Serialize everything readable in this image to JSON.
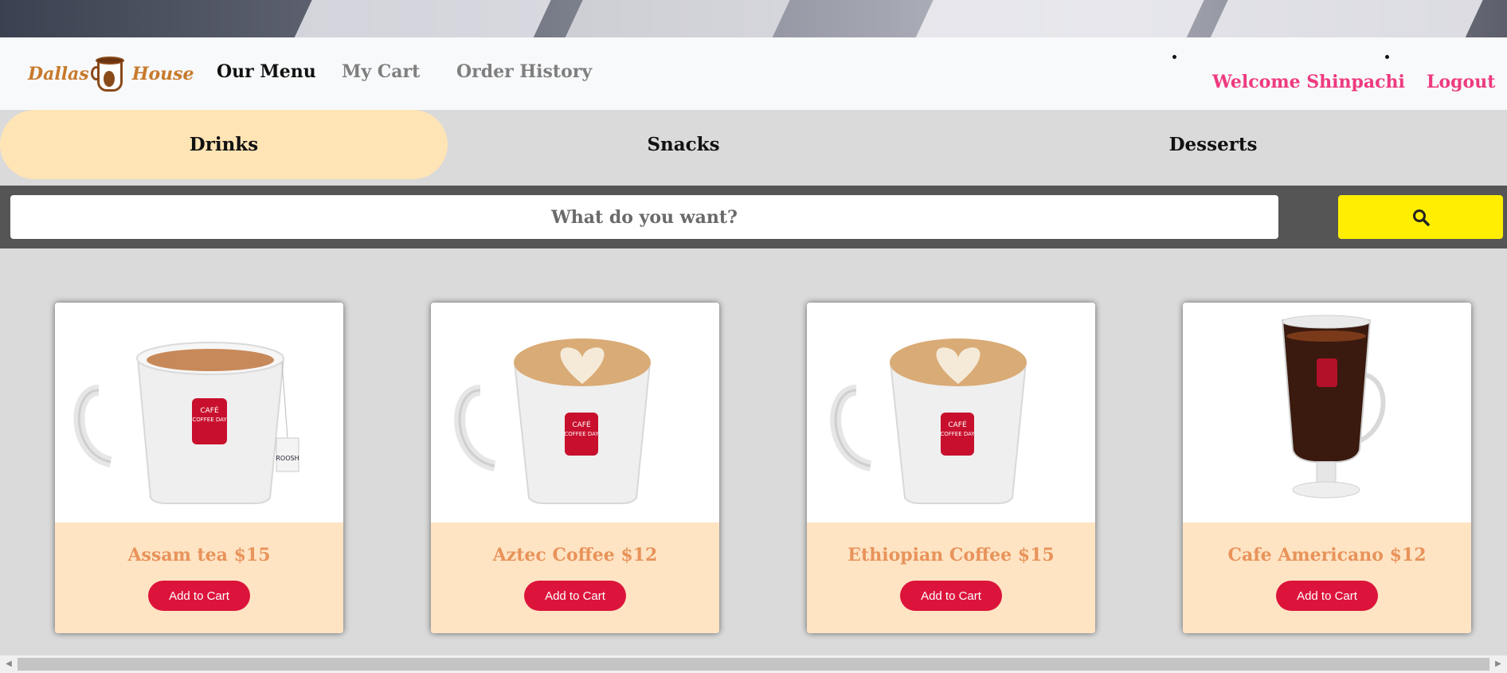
{
  "brand": {
    "left": "Dallas",
    "right": "House"
  },
  "nav": {
    "items": [
      {
        "label": "Our Menu",
        "active": true
      },
      {
        "label": "My Cart",
        "active": false
      },
      {
        "label": "Order History",
        "active": false
      }
    ],
    "welcome": "Welcome Shinpachi",
    "logout": "Logout"
  },
  "categories": [
    {
      "label": "Drinks",
      "active": true
    },
    {
      "label": "Snacks",
      "active": false
    },
    {
      "label": "Desserts",
      "active": false
    }
  ],
  "search": {
    "placeholder": "What do you want?",
    "icon": "search-icon"
  },
  "products": [
    {
      "title": "Assam tea $15",
      "button": "Add to Cart",
      "image": "tea-mug-image"
    },
    {
      "title": "Aztec Coffee $12",
      "button": "Add to Cart",
      "image": "latte-mug-image"
    },
    {
      "title": "Ethiopian Coffee $15",
      "button": "Add to Cart",
      "image": "latte-mug-image"
    },
    {
      "title": "Cafe Americano $12",
      "button": "Add to Cart",
      "image": "americano-glass-image"
    }
  ],
  "colors": {
    "accent_pink": "#ee3a80",
    "active_tab": "#ffe4b5",
    "search_button": "#ffee00",
    "add_button": "#dc143c",
    "card_info": "#ffe4c4",
    "card_title": "#e8935a"
  }
}
